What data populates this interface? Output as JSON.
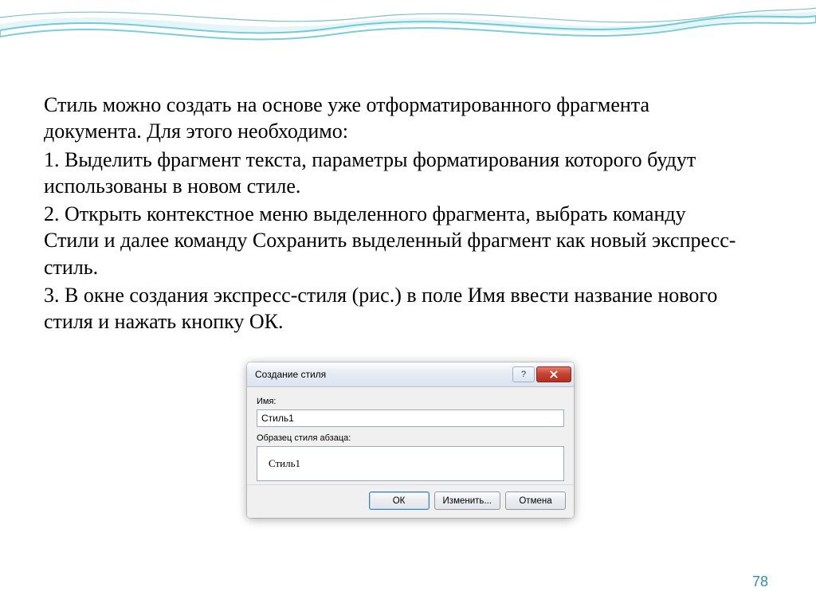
{
  "text": {
    "intro": "Стиль можно создать на основе уже отформатированного фрагмента документа. Для этого необходимо:",
    "step1": "1. Выделить фрагмент текста, параметры форматирования которого будут использованы в новом стиле.",
    "step2": "2. Открыть контекстное меню выделенного фрагмента, выбрать команду Стили и далее команду Сохранить выделенный фрагмент как новый экспресс-стиль.",
    "step3": "3. В окне создания экспресс-стиля (рис.) в поле Имя ввести название нового стиля и нажать кнопку ОК."
  },
  "dialog": {
    "title": "Создание стиля",
    "help_glyph": "?",
    "name_label": "Имя:",
    "name_value": "Стиль1",
    "preview_label": "Образец стиля абзаца:",
    "preview_text": "Стиль1",
    "ok_label": "ОК",
    "modify_label": "Изменить...",
    "cancel_label": "Отмена"
  },
  "page_number": "78"
}
